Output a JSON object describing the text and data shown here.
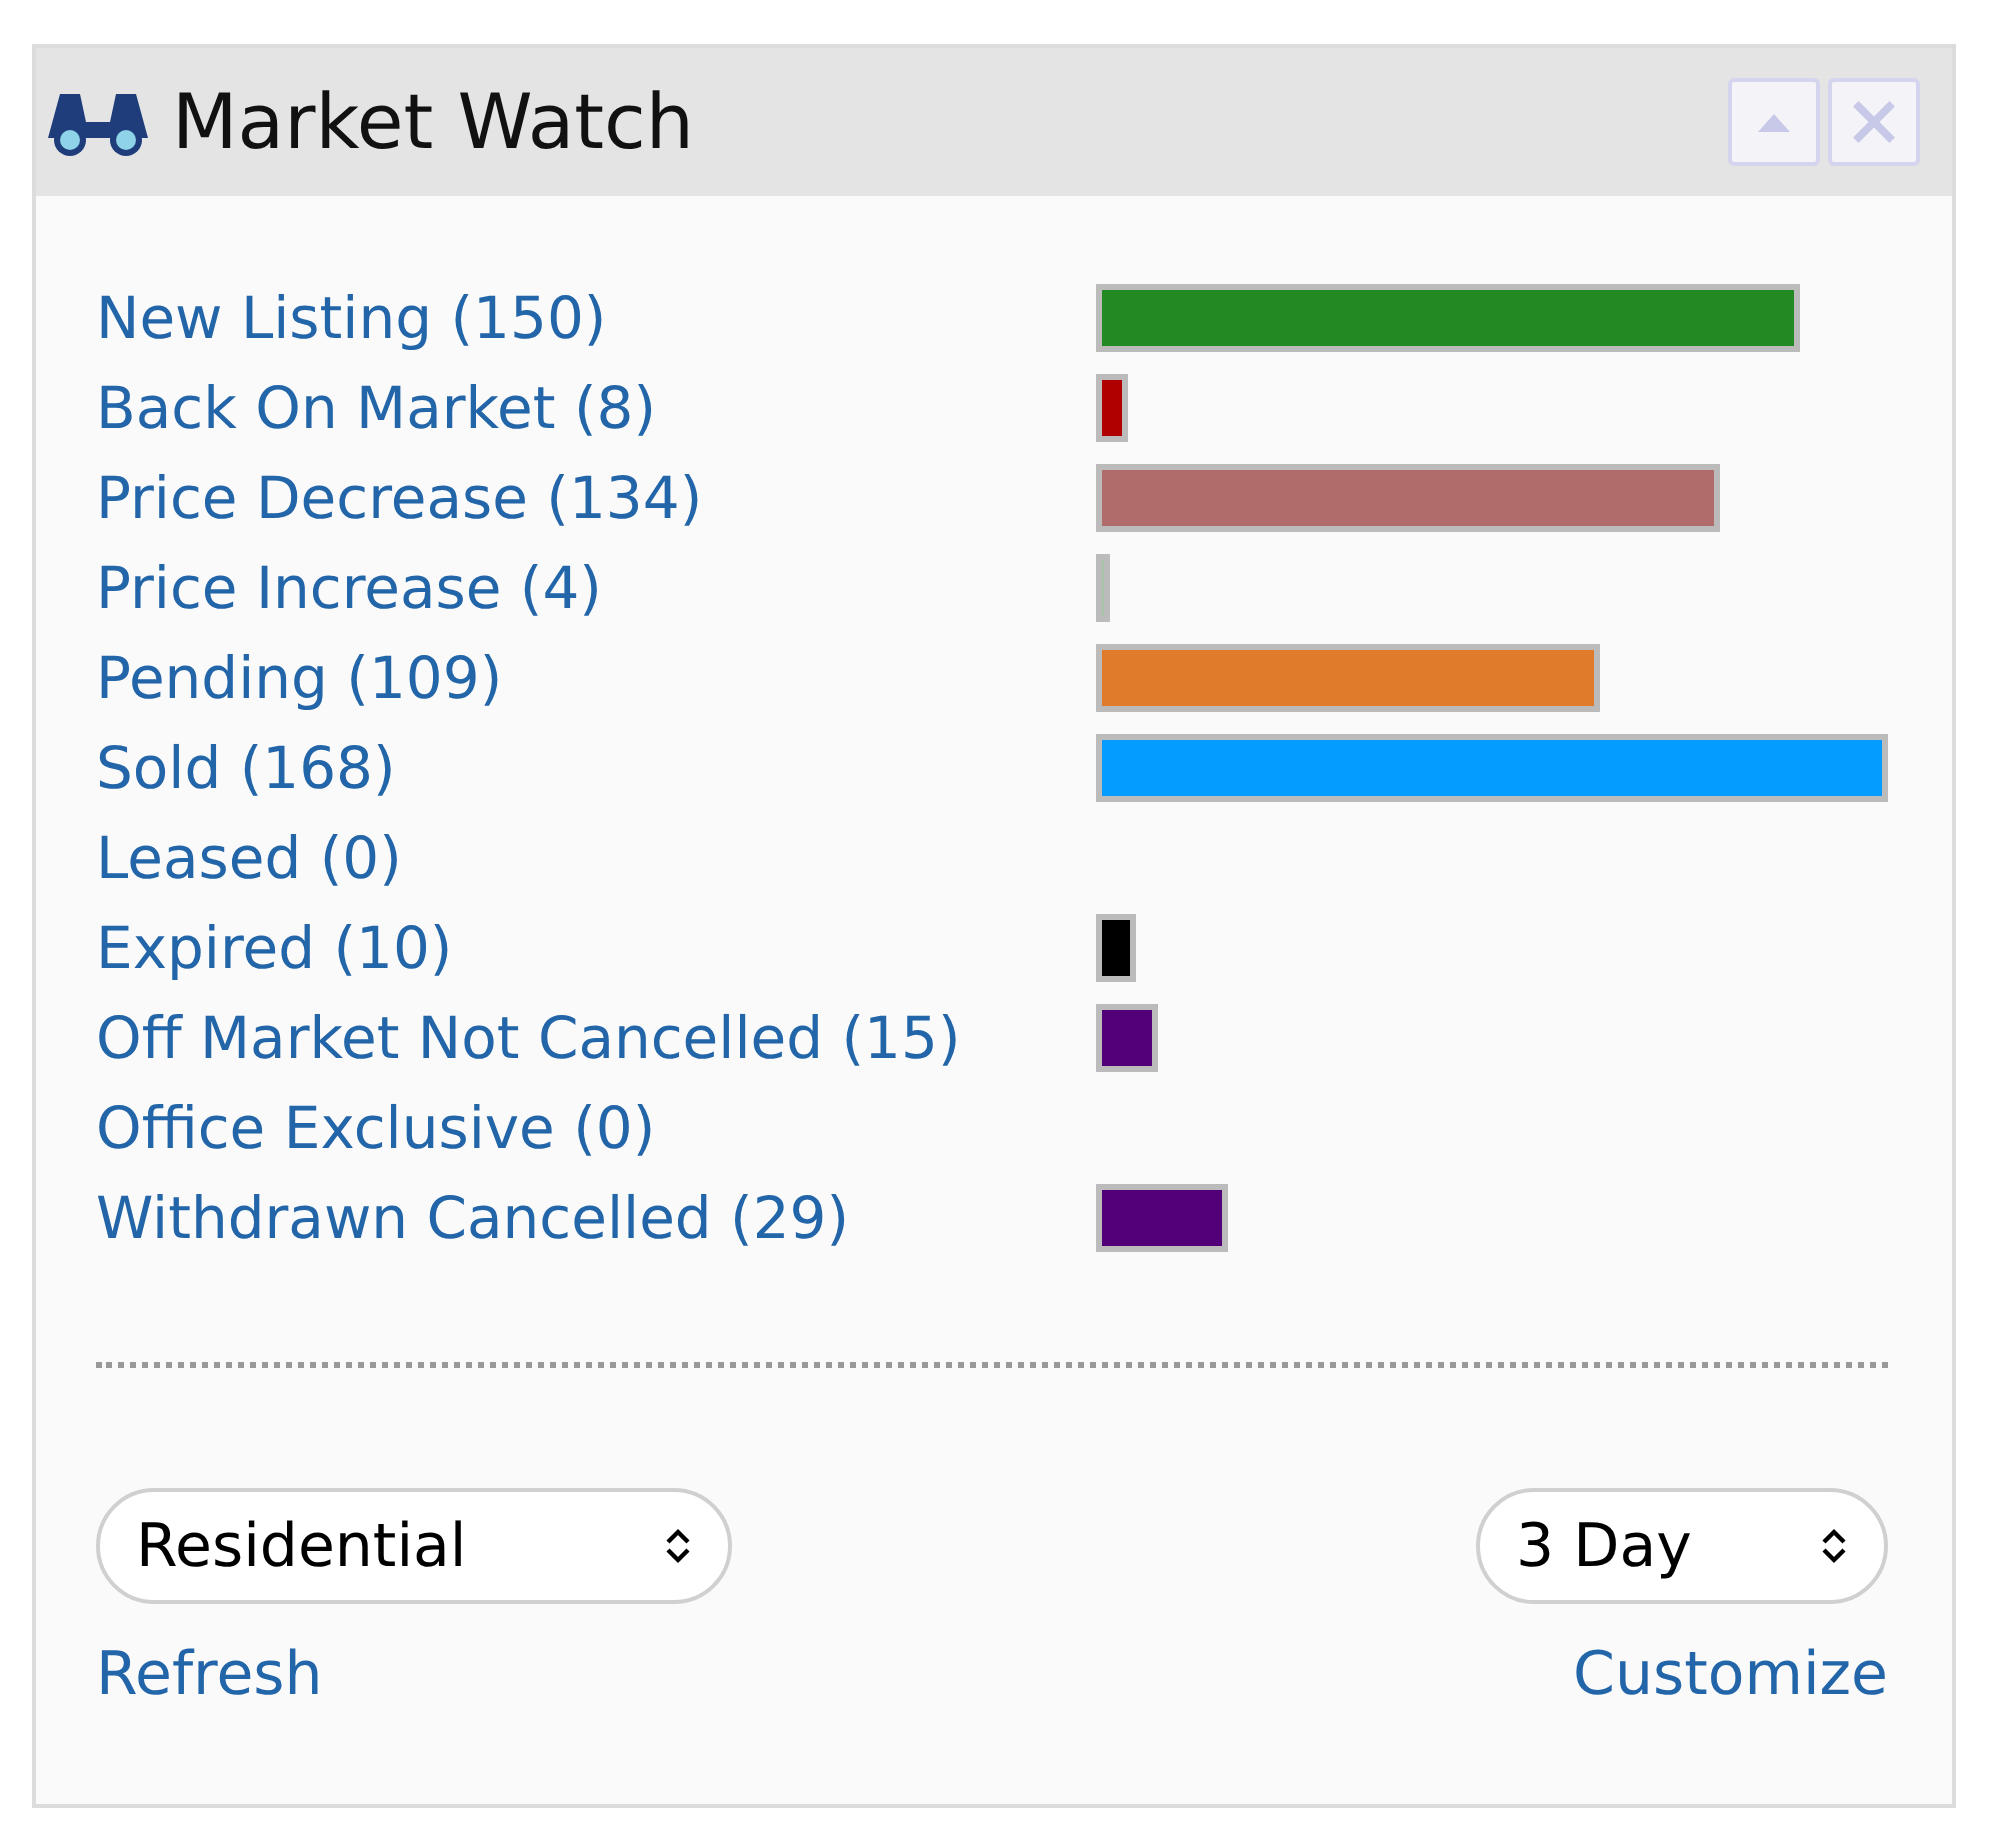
{
  "panel": {
    "title": "Market Watch"
  },
  "rows": [
    {
      "label": "New Listing (150)",
      "color": "#238a23"
    },
    {
      "label": "Back On Market (8)",
      "color": "#b00000"
    },
    {
      "label": "Price Decrease (134)",
      "color": "#b06b6b"
    },
    {
      "label": "Price Increase (4)",
      "color": "#a8c4a8"
    },
    {
      "label": "Pending (109)",
      "color": "#e07b2b"
    },
    {
      "label": "Sold (168)",
      "color": "#049dff"
    },
    {
      "label": "Leased (0)"
    },
    {
      "label": "Expired (10)",
      "color": "#000000"
    },
    {
      "label": "Off Market Not Cancelled (15)",
      "color": "#52007a"
    },
    {
      "label": "Office Exclusive (0)"
    },
    {
      "label": "Withdrawn Cancelled (29)",
      "color": "#52007a"
    }
  ],
  "filters": [
    {
      "value": "Residential"
    },
    {
      "value": "3 Day"
    }
  ],
  "links": [
    "Refresh",
    "Customize"
  ]
}
